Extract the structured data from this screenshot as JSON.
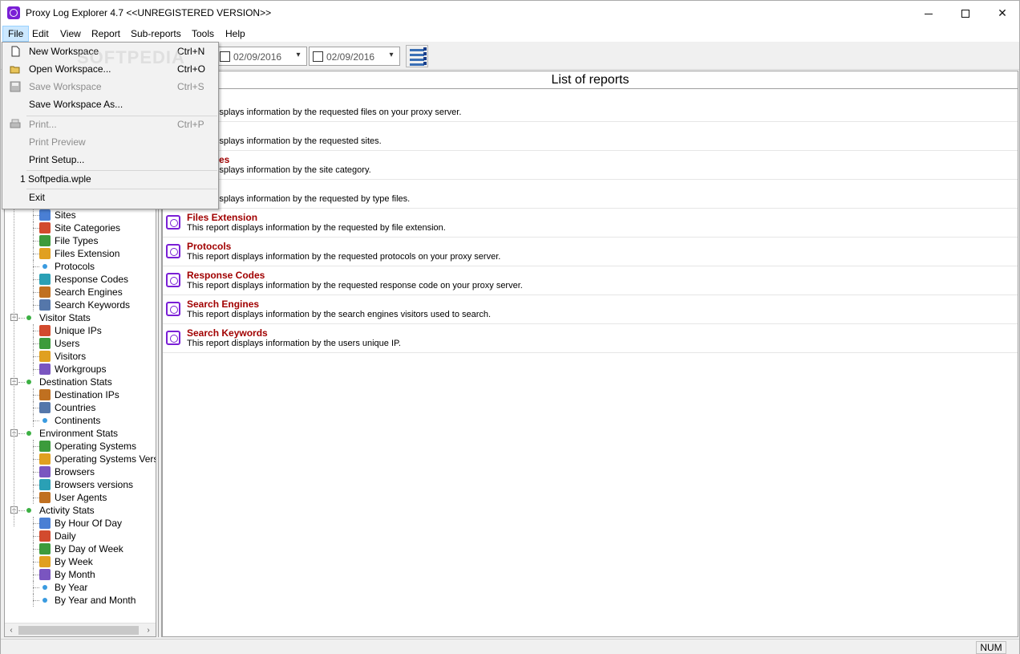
{
  "window": {
    "title": "Proxy Log Explorer 4.7 <<UNREGISTERED VERSION>>"
  },
  "menubar": {
    "items": [
      "File",
      "Edit",
      "View",
      "Report",
      "Sub-reports",
      "Tools",
      "Help"
    ]
  },
  "file_menu": {
    "items": [
      {
        "label": "New Workspace",
        "shortcut": "Ctrl+N",
        "enabled": true
      },
      {
        "label": "Open Workspace...",
        "shortcut": "Ctrl+O",
        "enabled": true
      },
      {
        "label": "Save Workspace",
        "shortcut": "Ctrl+S",
        "enabled": false
      },
      {
        "label": "Save Workspace As...",
        "shortcut": "",
        "enabled": true
      },
      {
        "label": "Print...",
        "shortcut": "Ctrl+P",
        "enabled": false
      },
      {
        "label": "Print Preview",
        "shortcut": "",
        "enabled": false
      },
      {
        "label": "Print Setup...",
        "shortcut": "",
        "enabled": true
      },
      {
        "label": "1 Softpedia.wple",
        "shortcut": "",
        "enabled": true
      },
      {
        "label": "Exit",
        "shortcut": "",
        "enabled": true
      }
    ]
  },
  "toolbar": {
    "date_from": "02/09/2016",
    "date_to": "02/09/2016"
  },
  "tree": {
    "rows": [
      {
        "label": "Sites",
        "level": 2
      },
      {
        "label": "Site Categories",
        "level": 2
      },
      {
        "label": "File Types",
        "level": 2
      },
      {
        "label": "Files Extension",
        "level": 2
      },
      {
        "label": "Protocols",
        "level": 2
      },
      {
        "label": "Response Codes",
        "level": 2
      },
      {
        "label": "Search Engines",
        "level": 2
      },
      {
        "label": "Search Keywords",
        "level": 2
      },
      {
        "label": "Visitor Stats",
        "level": 1
      },
      {
        "label": "Unique IPs",
        "level": 2
      },
      {
        "label": "Users",
        "level": 2
      },
      {
        "label": "Visitors",
        "level": 2
      },
      {
        "label": "Workgroups",
        "level": 2
      },
      {
        "label": "Destination Stats",
        "level": 1
      },
      {
        "label": "Destination IPs",
        "level": 2
      },
      {
        "label": "Countries",
        "level": 2
      },
      {
        "label": "Continents",
        "level": 2
      },
      {
        "label": "Environment Stats",
        "level": 1
      },
      {
        "label": "Operating Systems",
        "level": 2
      },
      {
        "label": "Operating Systems Version",
        "level": 2
      },
      {
        "label": "Browsers",
        "level": 2
      },
      {
        "label": "Browsers versions",
        "level": 2
      },
      {
        "label": "User Agents",
        "level": 2
      },
      {
        "label": "Activity Stats",
        "level": 1
      },
      {
        "label": "By Hour Of Day",
        "level": 2
      },
      {
        "label": "Daily",
        "level": 2
      },
      {
        "label": "By Day of Week",
        "level": 2
      },
      {
        "label": "By Week",
        "level": 2
      },
      {
        "label": "By Month",
        "level": 2
      },
      {
        "label": "By Year",
        "level": 2
      },
      {
        "label": "By Year and Month",
        "level": 2
      }
    ]
  },
  "reports": {
    "header": "List of reports",
    "items": [
      {
        "title": "ts",
        "desc": "report displays information by the requested files on your proxy server."
      },
      {
        "title": "",
        "desc": "report displays information by the requested sites."
      },
      {
        "title": "ategories",
        "desc": "report displays information by the site category."
      },
      {
        "title": "pes",
        "desc": "report displays information by the requested by type files."
      },
      {
        "title": "Files Extension",
        "desc": "This report displays information by the requested by file extension."
      },
      {
        "title": "Protocols",
        "desc": "This report displays information by the requested protocols on your proxy server."
      },
      {
        "title": "Response Codes",
        "desc": "This report displays information by the requested response code on your proxy server."
      },
      {
        "title": "Search Engines",
        "desc": "This report displays information by the search engines visitors used to search."
      },
      {
        "title": "Search Keywords",
        "desc": "This report displays information by the users unique IP."
      }
    ]
  },
  "statusbar": {
    "num": "NUM"
  },
  "watermark": "SOFTPEDIA",
  "colors": {
    "report_title": "#a10000",
    "app_accent": "#7a1fd6",
    "menu_highlight": "#cce8ff"
  }
}
